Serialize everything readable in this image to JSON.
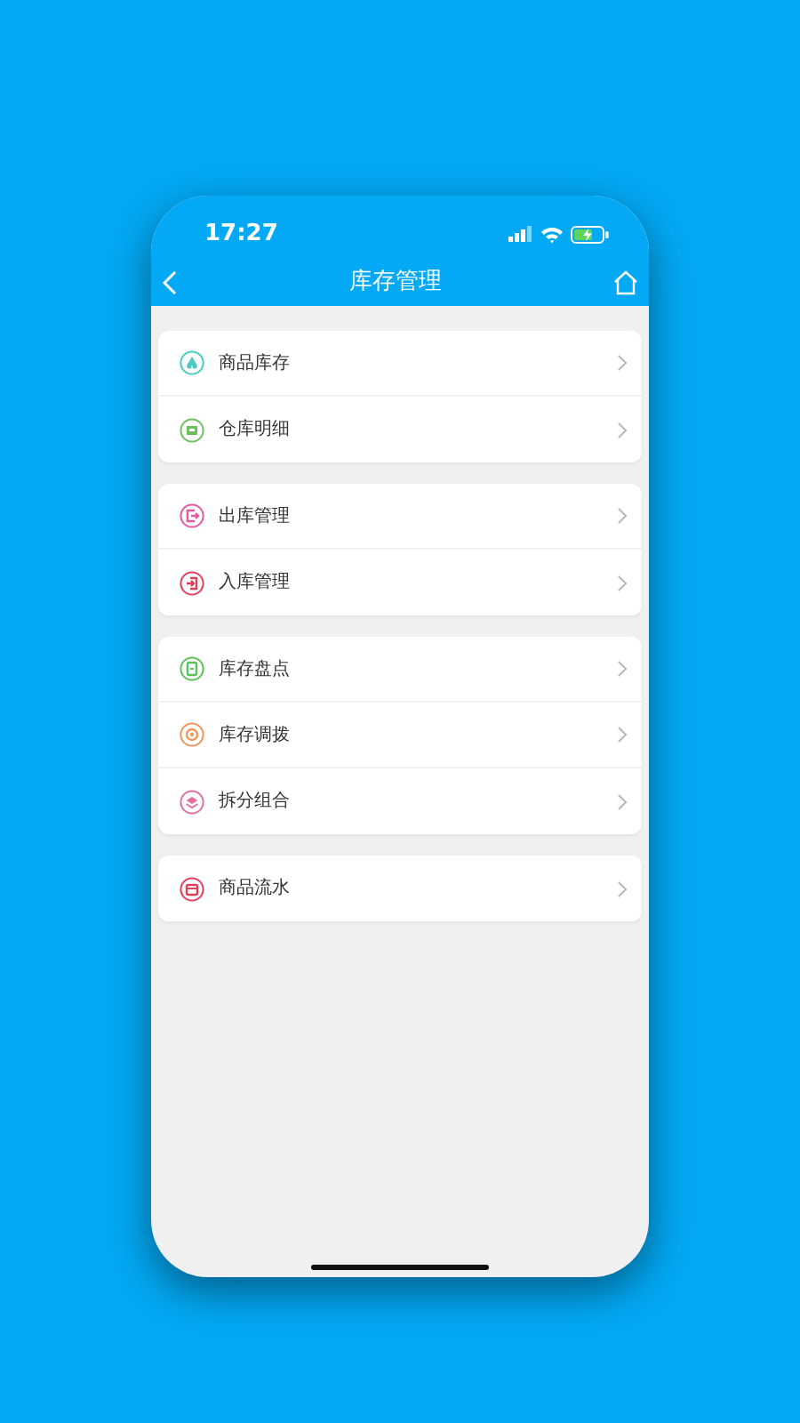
{
  "status_bar": {
    "time": "17:27"
  },
  "nav": {
    "title": "库存管理"
  },
  "groups": [
    {
      "items": [
        {
          "label": "商品库存",
          "kind": "stack",
          "color": "#4cc9c0"
        },
        {
          "label": "仓库明细",
          "kind": "box",
          "color": "#6cc05c"
        }
      ]
    },
    {
      "items": [
        {
          "label": "出库管理",
          "kind": "exit",
          "color": "#e05aa0"
        },
        {
          "label": "入库管理",
          "kind": "enter",
          "color": "#e0405a"
        }
      ]
    },
    {
      "items": [
        {
          "label": "库存盘点",
          "kind": "clipboard",
          "color": "#5cc05c"
        },
        {
          "label": "库存调拨",
          "kind": "target",
          "color": "#f0945a"
        },
        {
          "label": "拆分组合",
          "kind": "layers",
          "color": "#e070a0"
        }
      ]
    },
    {
      "items": [
        {
          "label": "商品流水",
          "kind": "calendar",
          "color": "#e0405a"
        }
      ]
    }
  ]
}
